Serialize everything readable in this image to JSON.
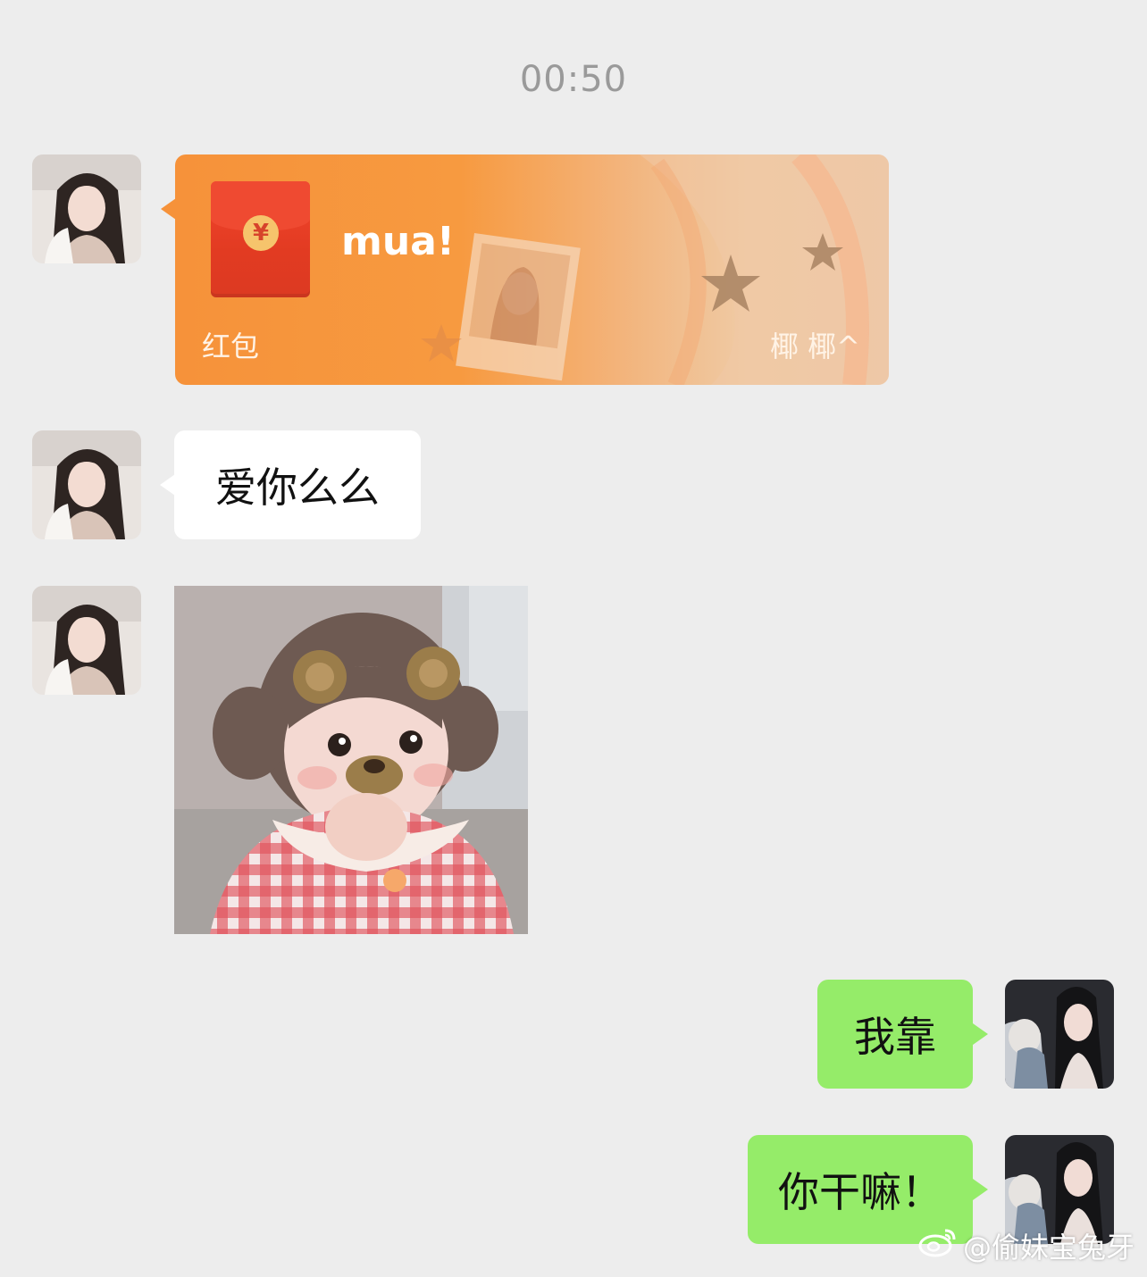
{
  "timestamp": "00:50",
  "messages": {
    "red_packet": {
      "title": "mua!",
      "type_label": "红包",
      "sender_label": "椰 椰^",
      "coin_symbol": "¥"
    },
    "text_1": "爱你么么",
    "text_2": "我靠",
    "text_3": "你干嘛！"
  },
  "watermark": "@偷妹宝兔牙",
  "colors": {
    "background": "#ededed",
    "outgoing_bubble": "#95ec69",
    "incoming_bubble": "#ffffff",
    "red_packet": "#f6923a"
  }
}
